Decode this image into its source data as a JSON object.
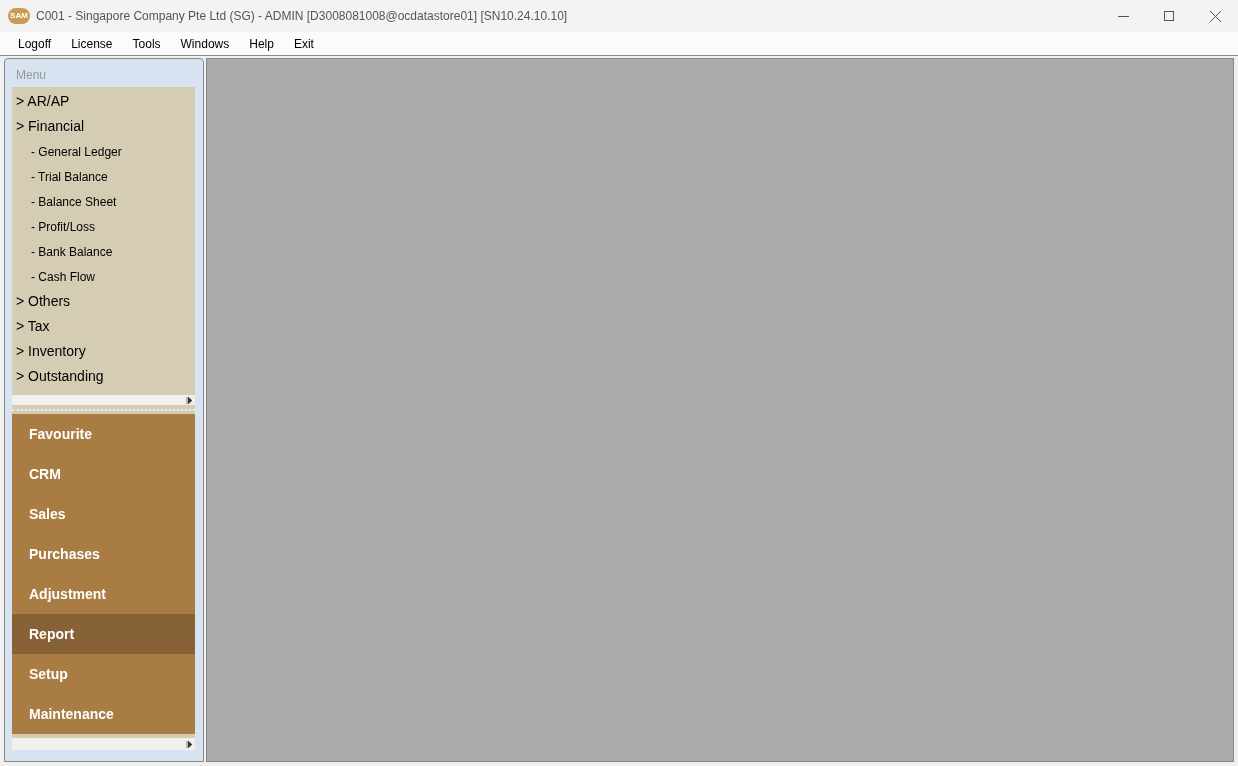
{
  "window": {
    "logo_text": "SAM",
    "title": "C001 - Singapore Company Pte Ltd (SG) - ADMIN [D3008081008@ocdatastore01] [SN10.24.10.10]"
  },
  "menu_bar": [
    "Logoff",
    "License",
    "Tools",
    "Windows",
    "Help",
    "Exit"
  ],
  "sidebar": {
    "heading": "Menu",
    "tree": [
      {
        "label": "> AR/AP"
      },
      {
        "label": "> Financial",
        "children": [
          {
            "label": "- General Ledger"
          },
          {
            "label": "- Trial Balance"
          },
          {
            "label": "- Balance Sheet"
          },
          {
            "label": "- Profit/Loss"
          },
          {
            "label": "- Bank Balance"
          },
          {
            "label": "- Cash Flow"
          }
        ]
      },
      {
        "label": "> Others"
      },
      {
        "label": "> Tax"
      },
      {
        "label": "> Inventory"
      },
      {
        "label": "> Outstanding"
      }
    ],
    "sections": [
      {
        "label": "Favourite",
        "selected": false
      },
      {
        "label": "CRM",
        "selected": false
      },
      {
        "label": "Sales",
        "selected": false
      },
      {
        "label": "Purchases",
        "selected": false
      },
      {
        "label": "Adjustment",
        "selected": false
      },
      {
        "label": "Report",
        "selected": true
      },
      {
        "label": "Setup",
        "selected": false
      },
      {
        "label": "Maintenance",
        "selected": false
      }
    ]
  }
}
